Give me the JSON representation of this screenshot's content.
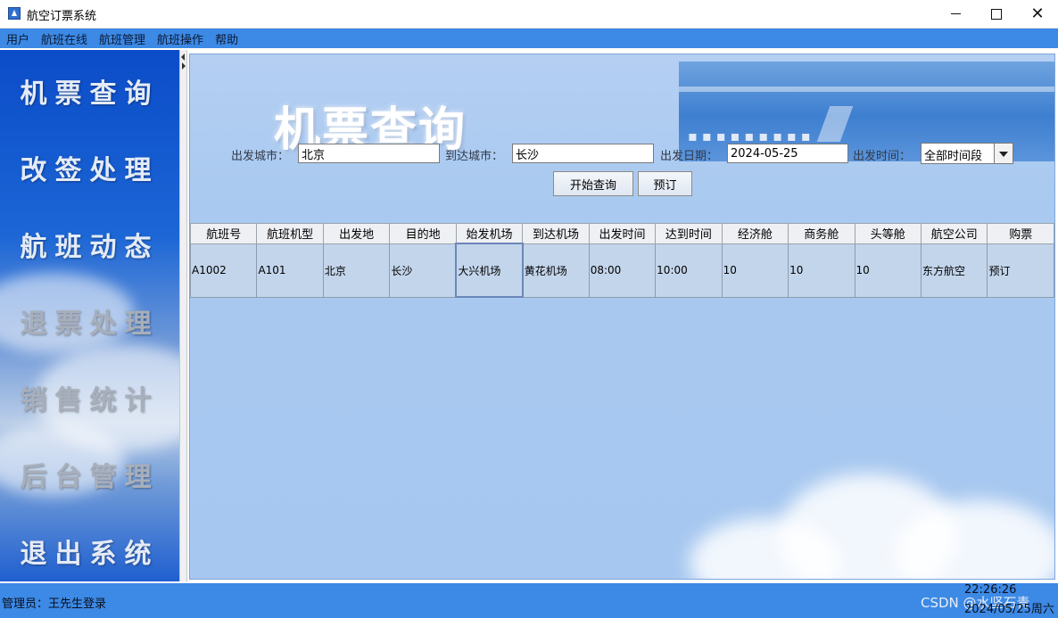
{
  "window": {
    "title": "航空订票系统"
  },
  "menu": [
    "用户",
    "航班在线",
    "航班管理",
    "航班操作",
    "帮助"
  ],
  "nav": [
    "机票查询",
    "改签处理",
    "航班动态",
    "退票处理",
    "销售统计",
    "后台管理",
    "退出系统"
  ],
  "page": {
    "title": "机票查询"
  },
  "query": {
    "from_label": "出发城市：",
    "from_value": "北京",
    "to_label": "到达城市：",
    "to_value": "长沙",
    "date_label": "出发日期：",
    "date_value": "2024-05-25",
    "time_label": "出发时间：",
    "time_value": "全部时间段",
    "search_label": "开始查询",
    "book_label": "预订"
  },
  "table": {
    "headers": [
      "航班号",
      "航班机型",
      "出发地",
      "目的地",
      "始发机场",
      "到达机场",
      "出发时间",
      "达到时间",
      "经济舱",
      "商务舱",
      "头等舱",
      "航空公司",
      "购票"
    ],
    "rows": [
      [
        "A1002",
        "A101",
        "北京",
        "长沙",
        "大兴机场",
        "黄花机场",
        "08:00",
        "10:00",
        "10",
        "10",
        "10",
        "东方航空",
        "预订"
      ]
    ]
  },
  "status": {
    "user": "管理员：王先生登录",
    "time": "22:26:26",
    "date": "2024/05/25周六",
    "watermark": "CSDN @水坚石青"
  },
  "colors": {
    "accent": "#3c89e6",
    "panel": "#a9c9f0"
  }
}
